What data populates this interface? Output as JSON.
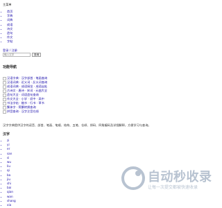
{
  "menu_title": "主菜单",
  "nav": [
    "首页",
    "字典",
    "词典",
    "成语",
    "诗文",
    "造句",
    "作文",
    "字帖"
  ],
  "login": "登录 / 注册",
  "search": {
    "placeholder": "输入汉字",
    "button": "查询"
  },
  "sections": {
    "functions": "功能导航",
    "hanzi": "汉字"
  },
  "functions": [
    "汉语字典 · 汉字部首 · 笔画查询",
    "汉语词典 · 近义词 · 反义词查询",
    "成语词典 · 成语接龙 · 成语出处",
    "古诗文 · 唐诗 · 宋词 · 元曲大全",
    "造句大全 · 词语造句查询",
    "作文大全 · 小学 · 初中 · 高中",
    "书法字帖 · 楷书 · 行书 · 草书",
    "繁体字 · 简繁转换查询",
    "拼音查询 · 汉字注音在线"
  ],
  "description": "汉字字典提供汉字的读音、部首、笔画、笔顺、结构、五笔、仓颉、郑码、四角编码及详细解释，方便学习与查询。",
  "hanzi": [
    "zi",
    "yi",
    "er",
    "san",
    "si",
    "wu",
    "liu",
    "qi",
    "ba",
    "jiu",
    "shi",
    "bai",
    "qian",
    "wan",
    "shang",
    "xia"
  ],
  "watermark": {
    "title": "自动秒收录",
    "subtitle": "让每一次提交都被快速收录"
  },
  "colors": {
    "link": "#1a0dab",
    "watermark": "#b8c3d1"
  }
}
